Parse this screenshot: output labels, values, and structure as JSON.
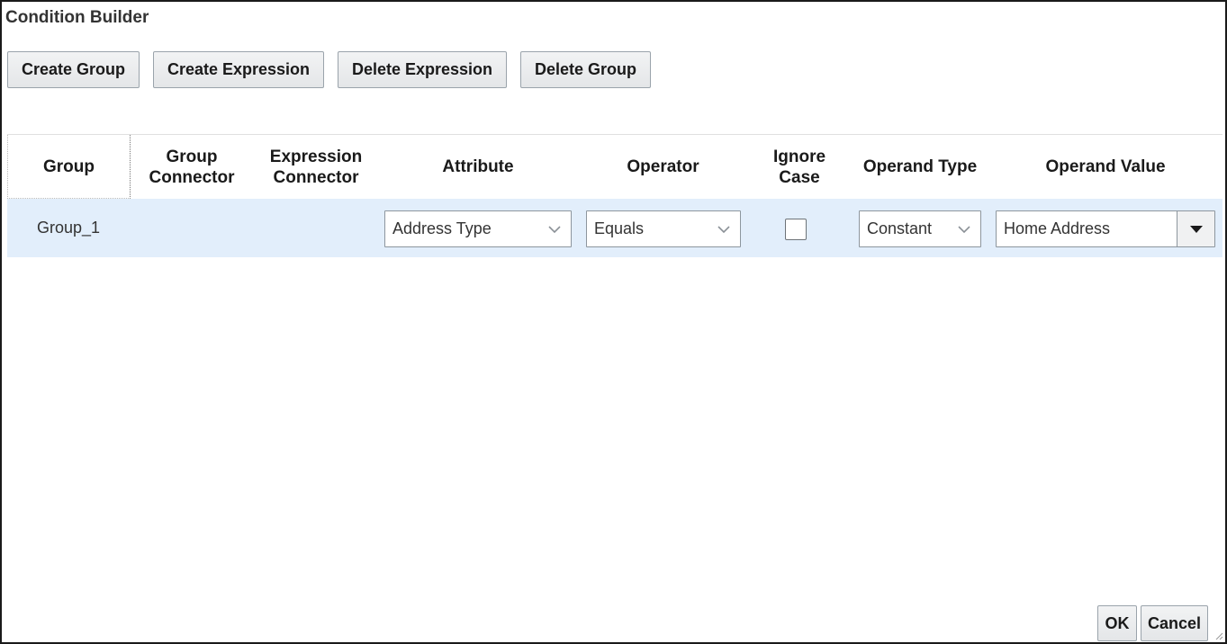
{
  "dialog": {
    "title": "Condition Builder"
  },
  "toolbar": {
    "create_group": "Create Group",
    "create_expression": "Create Expression",
    "delete_expression": "Delete Expression",
    "delete_group": "Delete Group"
  },
  "table": {
    "headers": {
      "group": "Group",
      "group_connector": "Group Connector",
      "expression_connector": "Expression Connector",
      "attribute": "Attribute",
      "operator": "Operator",
      "ignore_case": "Ignore Case",
      "operand_type": "Operand Type",
      "operand_value": "Operand Value"
    },
    "rows": [
      {
        "group": "Group_1",
        "group_connector": "",
        "expression_connector": "",
        "attribute": "Address Type",
        "operator": "Equals",
        "ignore_case": false,
        "operand_type": "Constant",
        "operand_value": "Home Address"
      }
    ]
  },
  "footer": {
    "ok": "OK",
    "cancel": "Cancel"
  },
  "colors": {
    "row_highlight": "#e2eefb",
    "button_bg": "#e8eaec",
    "border": "#8d969e"
  },
  "icons": {
    "select_chevron": "chevron-down-icon",
    "combo_arrow": "caret-down-icon",
    "resize": "resize-grip-icon"
  }
}
